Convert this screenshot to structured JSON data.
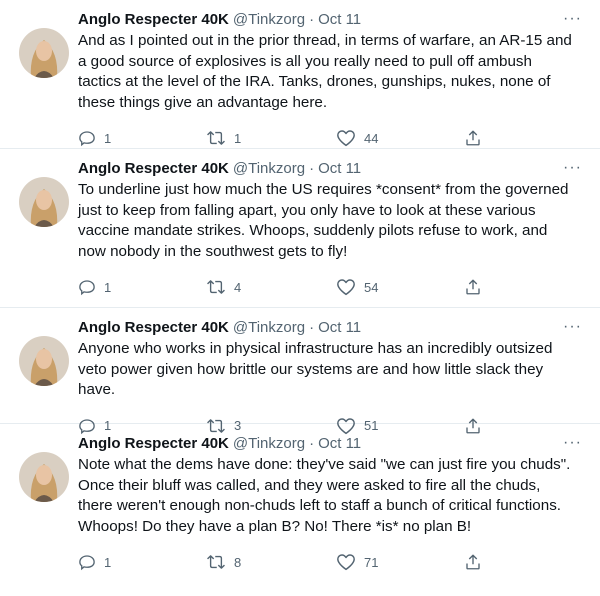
{
  "tweets": [
    {
      "author": "Anglo Respecter 40K",
      "handle": "@Tinkzorg",
      "separator": "·",
      "date": "Oct 11",
      "more": "···",
      "text": "And as I pointed out in the prior thread, in terms of warfare, an AR-15 and a good source of explosives is all you really need to pull off ambush tactics at the level of the IRA. Tanks, drones, gunships, nukes, none of these things give an advantage here.",
      "replies": "1",
      "retweets": "1",
      "likes": "44"
    },
    {
      "author": "Anglo Respecter 40K",
      "handle": "@Tinkzorg",
      "separator": "·",
      "date": "Oct 11",
      "more": "···",
      "text": "To underline just how much the US requires *consent* from the governed just to keep from falling apart, you only have to look at these various vaccine mandate strikes. Whoops, suddenly pilots refuse to work, and now nobody in the southwest gets to fly!",
      "replies": "1",
      "retweets": "4",
      "likes": "54"
    },
    {
      "author": "Anglo Respecter 40K",
      "handle": "@Tinkzorg",
      "separator": "·",
      "date": "Oct 11",
      "more": "···",
      "text": "Anyone who works in physical infrastructure has an incredibly outsized veto power given how brittle our systems are and how little slack they have.",
      "replies": "1",
      "retweets": "3",
      "likes": "51"
    },
    {
      "author": "Anglo Respecter 40K",
      "handle": "@Tinkzorg",
      "separator": "·",
      "date": "Oct 11",
      "more": "···",
      "text": "Note what the dems have done: they've said \"we can just fire you chuds\". Once their bluff was called, and they were asked to fire all the chuds, there weren't enough non-chuds left to staff a bunch of critical functions. Whoops! Do they have a plan B? No! There *is* no plan B!",
      "replies": "1",
      "retweets": "8",
      "likes": "71"
    }
  ],
  "icons": {
    "avatar": "avatar-photo",
    "reply": "reply-icon",
    "retweet": "retweet-icon",
    "like": "heart-icon",
    "share": "share-icon"
  },
  "colors": {
    "text": "#0f1419",
    "secondary": "#536471",
    "divider": "#e6ecf0"
  }
}
